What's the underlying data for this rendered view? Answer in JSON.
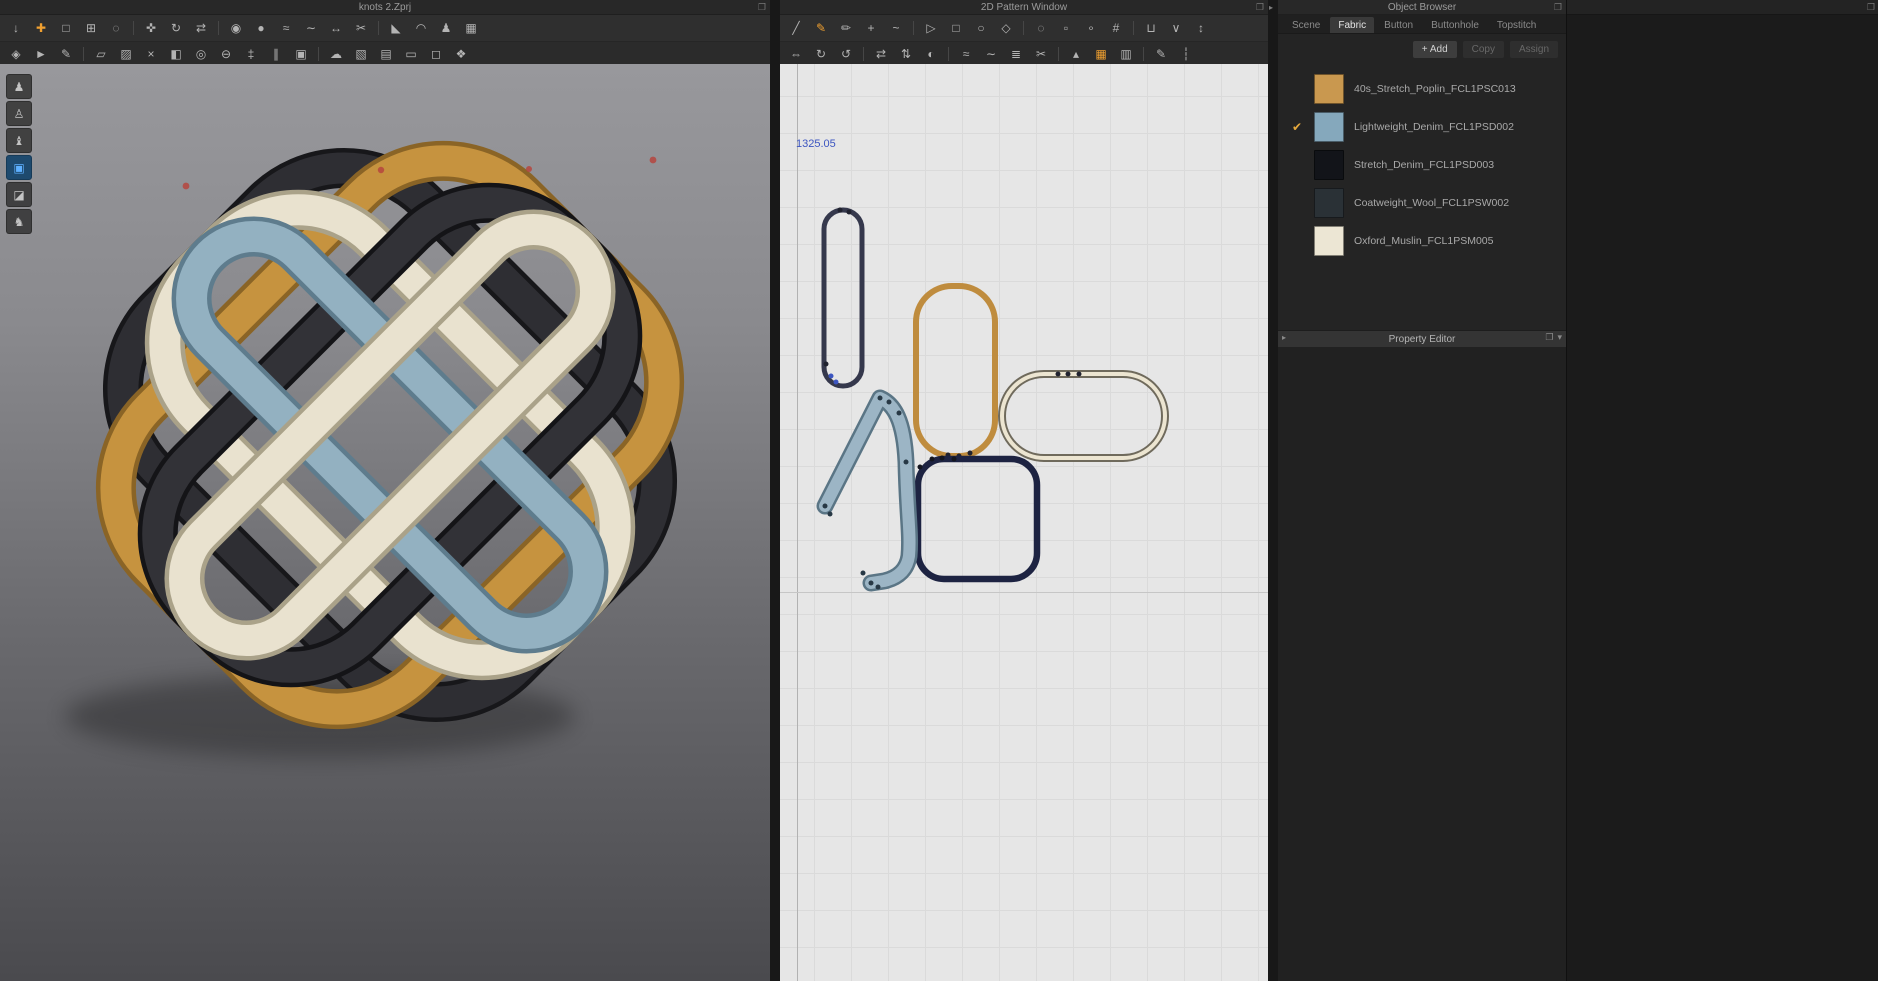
{
  "panels": {
    "viewport3d": {
      "title": "knots 2.Zprj"
    },
    "pattern2d": {
      "title": "2D Pattern Window",
      "measure_label": "1325.05"
    },
    "object_browser": {
      "title": "Object Browser",
      "tabs": [
        {
          "label": "Scene"
        },
        {
          "label": "Fabric",
          "active": true
        },
        {
          "label": "Button"
        },
        {
          "label": "Buttonhole"
        },
        {
          "label": "Topstitch"
        }
      ],
      "actions": {
        "add": "+ Add",
        "copy": "Copy",
        "assign": "Assign"
      },
      "check_glyph": "✔",
      "fabrics": [
        {
          "name": "40s_Stretch_Poplin_FCL1PSC013",
          "color": "#c9984f"
        },
        {
          "name": "Lightweight_Denim_FCL1PSD002",
          "color": "#85a8bc",
          "checked": true
        },
        {
          "name": "Stretch_Denim_FCL1PSD003",
          "color": "#121419"
        },
        {
          "name": "Coatweight_Wool_FCL1PSW002",
          "color": "#2a3136"
        },
        {
          "name": "Oxford_Muslin_FCL1PSM005",
          "color": "#ece6d4"
        }
      ],
      "property_editor_title": "Property Editor"
    }
  },
  "chrome": {
    "float_glyph": "❐",
    "splitter_glyph": "▸",
    "menu_glyph": "▾"
  },
  "colors": {
    "accent_orange": "#f0a030",
    "selection_blue": "#3c55c0",
    "active_tool_blue": "#5fb0ff",
    "canvas_bg": "#e6e6e6",
    "panel_bg": "#242424"
  },
  "toolbars": {
    "left_row1": [
      {
        "name": "simulate-icon",
        "glyph": "↓"
      },
      {
        "name": "select-move-icon",
        "glyph": "✚",
        "accent": true
      },
      {
        "name": "box-select-icon",
        "glyph": "□"
      },
      {
        "name": "mesh-select-icon",
        "glyph": "⊞"
      },
      {
        "name": "lasso-select-icon",
        "glyph": "◌"
      },
      {
        "sep": true
      },
      {
        "name": "move-pattern-icon",
        "glyph": "✜"
      },
      {
        "name": "rotate-pattern-icon",
        "glyph": "↻"
      },
      {
        "name": "flip-pattern-icon",
        "glyph": "⇄"
      },
      {
        "sep": true
      },
      {
        "name": "pin-icon",
        "glyph": "◉"
      },
      {
        "name": "tack-on-avatar-icon",
        "glyph": "●"
      },
      {
        "name": "segment-sew-icon",
        "glyph": "≈"
      },
      {
        "name": "free-sew-icon",
        "glyph": "∼"
      },
      {
        "name": "measure-tape-icon",
        "glyph": "↔"
      },
      {
        "name": "scissors-icon",
        "glyph": "✂"
      },
      {
        "sep": true
      },
      {
        "name": "fold-arrangement-icon",
        "glyph": "◣"
      },
      {
        "name": "wind-icon",
        "glyph": "◠"
      },
      {
        "name": "avatar-display-icon",
        "glyph": "♟"
      },
      {
        "name": "render-display-icon",
        "glyph": "▦"
      }
    ],
    "left_row2": [
      {
        "name": "pose-editor-icon",
        "glyph": "◈"
      },
      {
        "name": "pick-move-icon",
        "glyph": "►"
      },
      {
        "name": "pen-3d-icon",
        "glyph": "✎"
      },
      {
        "sep": true
      },
      {
        "name": "pattern-outline-icon",
        "glyph": "▱"
      },
      {
        "name": "internal-shape-icon",
        "glyph": "▨"
      },
      {
        "name": "baste-icon",
        "glyph": "×"
      },
      {
        "name": "fold-icon",
        "glyph": "◧"
      },
      {
        "name": "button-icon",
        "glyph": "◎"
      },
      {
        "name": "buttonhole-icon",
        "glyph": "⊖"
      },
      {
        "name": "zipper-icon",
        "glyph": "‡"
      },
      {
        "name": "topstitch-icon",
        "glyph": "∥"
      },
      {
        "name": "shrinkage-icon",
        "glyph": "▣"
      },
      {
        "sep": true
      },
      {
        "name": "steam-icon",
        "glyph": "☁"
      },
      {
        "name": "solidify-icon",
        "glyph": "▧"
      },
      {
        "name": "quilting-icon",
        "glyph": "▤"
      },
      {
        "name": "flatten-icon",
        "glyph": "▭"
      },
      {
        "name": "uv-map-icon",
        "glyph": "◻"
      },
      {
        "name": "bind-icon",
        "glyph": "❖"
      }
    ],
    "mid_row1": [
      {
        "name": "edit-pattern-icon",
        "glyph": "╱"
      },
      {
        "name": "edit-curvature-icon",
        "glyph": "✎",
        "accent": true
      },
      {
        "name": "edit-point-icon",
        "glyph": "✏"
      },
      {
        "name": "add-point-icon",
        "glyph": "+"
      },
      {
        "name": "edit-curve-point-icon",
        "glyph": "~"
      },
      {
        "sep": true
      },
      {
        "name": "polygon-tool-icon",
        "glyph": "▷"
      },
      {
        "name": "rectangle-tool-icon",
        "glyph": "□"
      },
      {
        "name": "circle-tool-icon",
        "glyph": "○"
      },
      {
        "name": "dart-tool-icon",
        "glyph": "◇"
      },
      {
        "sep": true
      },
      {
        "name": "internal-polygon-icon",
        "glyph": "◌"
      },
      {
        "name": "internal-rectangle-icon",
        "glyph": "▫"
      },
      {
        "name": "internal-circle-icon",
        "glyph": "∘"
      },
      {
        "name": "trace-icon",
        "glyph": "#"
      },
      {
        "sep": true
      },
      {
        "name": "seam-allowance-icon",
        "glyph": "⊔"
      },
      {
        "name": "notch-icon",
        "glyph": "∨"
      },
      {
        "name": "grainline-icon",
        "glyph": "↕"
      }
    ],
    "mid_row2": [
      {
        "name": "transform-pattern-icon",
        "glyph": "⇔"
      },
      {
        "name": "rotate-cw-icon",
        "glyph": "↻"
      },
      {
        "name": "rotate-ccw-icon",
        "glyph": "↺"
      },
      {
        "sep": true
      },
      {
        "name": "flip-horizontal-icon",
        "glyph": "⇄"
      },
      {
        "name": "flip-vertical-icon",
        "glyph": "⇅"
      },
      {
        "name": "unfold-icon",
        "glyph": "◐"
      },
      {
        "sep": true
      },
      {
        "name": "segment-sewing-icon",
        "glyph": "≈"
      },
      {
        "name": "free-sewing-icon",
        "glyph": "∼"
      },
      {
        "name": "mn-sewing-icon",
        "glyph": "≣"
      },
      {
        "name": "edit-sewing-icon",
        "glyph": "✂"
      },
      {
        "sep": true
      },
      {
        "name": "grading-icon",
        "glyph": "▴"
      },
      {
        "name": "colorway-icon",
        "glyph": "▦",
        "accent": true
      },
      {
        "name": "print-layout-icon",
        "glyph": "▥"
      },
      {
        "sep": true
      },
      {
        "name": "annotation-icon",
        "glyph": "✎"
      },
      {
        "name": "guideline-icon",
        "glyph": "┆"
      }
    ],
    "side3d": [
      {
        "name": "show-avatar-icon",
        "glyph": "♟"
      },
      {
        "name": "show-garment-icon",
        "glyph": "♙"
      },
      {
        "name": "show-mannequin-icon",
        "glyph": "♝"
      },
      {
        "name": "screen-mode-icon",
        "glyph": "▣",
        "active": true
      },
      {
        "name": "show-style-line-icon",
        "glyph": "◪"
      },
      {
        "name": "show-figure-icon",
        "glyph": "♞"
      }
    ]
  }
}
